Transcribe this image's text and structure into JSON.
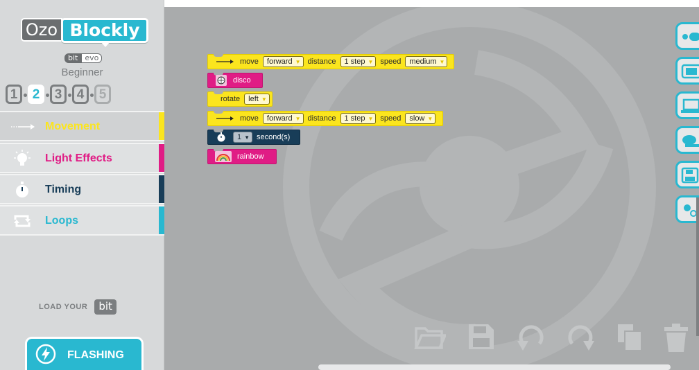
{
  "logo": {
    "ozo": "Ozo",
    "blockly": "Blockly"
  },
  "version": {
    "left": "bit",
    "right": "evo"
  },
  "level": {
    "label": "Beginner",
    "levels": [
      "1",
      "2",
      "3",
      "4",
      "5"
    ],
    "active": "2"
  },
  "categories": [
    {
      "label": "Movement",
      "color": "#fbe51e",
      "icon": "arrow-right-icon"
    },
    {
      "label": "Light Effects",
      "color": "#e01c85",
      "icon": "bulb-icon"
    },
    {
      "label": "Timing",
      "color": "#183d58",
      "icon": "stopwatch-icon"
    },
    {
      "label": "Loops",
      "color": "#29b8d0",
      "icon": "loop-icon"
    }
  ],
  "load": {
    "text": "LOAD YOUR",
    "badge": "bit"
  },
  "flash": {
    "label": "FLASHING"
  },
  "blocks": [
    {
      "type": "move",
      "parts": [
        "move",
        "forward",
        "distance",
        "1 step",
        "speed",
        "medium"
      ]
    },
    {
      "type": "light",
      "parts": [
        "disco"
      ]
    },
    {
      "type": "rotate",
      "parts": [
        "rotate",
        "left"
      ]
    },
    {
      "type": "move",
      "parts": [
        "move",
        "forward",
        "distance",
        "1 step",
        "speed",
        "slow"
      ]
    },
    {
      "type": "timing",
      "parts": [
        "1",
        "second(s)"
      ]
    },
    {
      "type": "light",
      "parts": [
        "rainbow"
      ]
    }
  ],
  "right_tabs": [
    "line-following-icon",
    "tv-icon",
    "laptop-icon",
    "brain-icon",
    "save-cloud-icon",
    "settings-icon"
  ],
  "toolbar": [
    "folder-open-icon",
    "save-icon",
    "undo-icon",
    "redo-icon",
    "copy-icon",
    "trash-icon"
  ],
  "colors": {
    "accent": "#29b8d0",
    "movement": "#fbe51e",
    "light": "#e01c85",
    "timing": "#183d58",
    "workspace": "#a9abac"
  }
}
